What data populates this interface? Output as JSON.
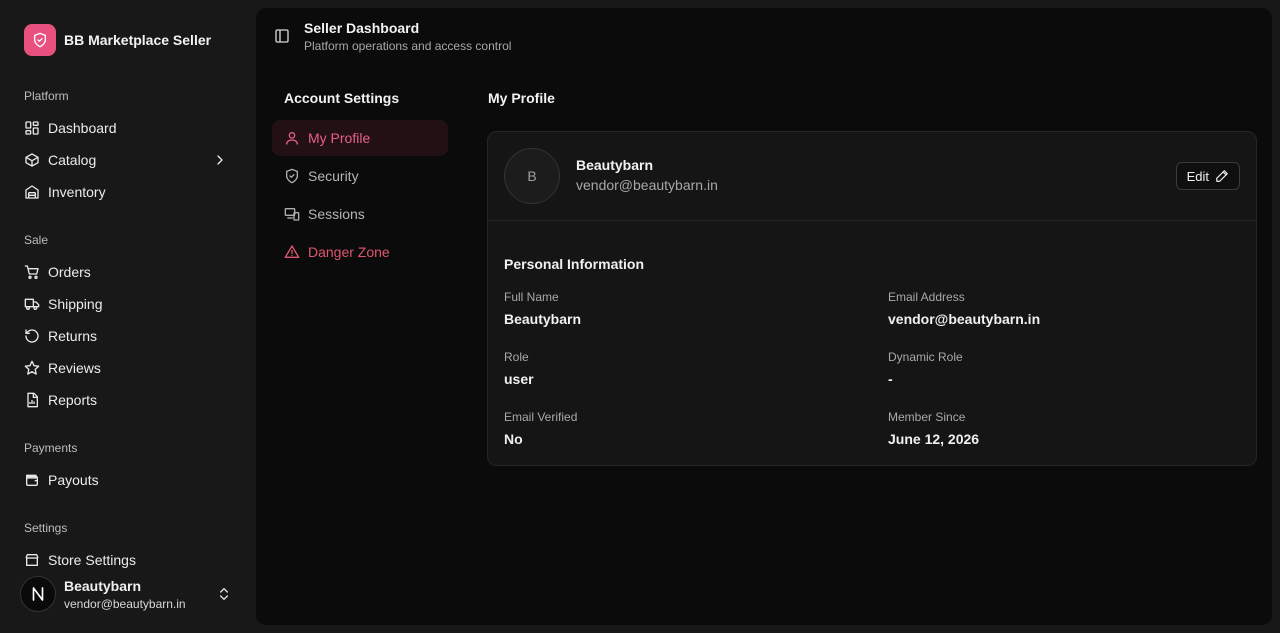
{
  "brand": {
    "name": "BB Marketplace Seller",
    "logo_icon": "shield-check-icon",
    "accent": "#e8517f"
  },
  "sidebar": {
    "groups": [
      {
        "title": "Platform",
        "items": [
          {
            "label": "Dashboard",
            "icon": "dashboard-icon"
          },
          {
            "label": "Catalog",
            "icon": "package-icon",
            "has_submenu": true
          },
          {
            "label": "Inventory",
            "icon": "warehouse-icon"
          }
        ]
      },
      {
        "title": "Sale",
        "items": [
          {
            "label": "Orders",
            "icon": "cart-icon"
          },
          {
            "label": "Shipping",
            "icon": "truck-icon"
          },
          {
            "label": "Returns",
            "icon": "rotate-ccw-icon"
          },
          {
            "label": "Reviews",
            "icon": "star-icon"
          },
          {
            "label": "Reports",
            "icon": "report-icon"
          }
        ]
      },
      {
        "title": "Payments",
        "items": [
          {
            "label": "Payouts",
            "icon": "wallet-icon"
          }
        ]
      },
      {
        "title": "Settings",
        "items": [
          {
            "label": "Store Settings",
            "icon": "store-icon"
          }
        ]
      }
    ]
  },
  "user": {
    "name": "Beautybarn",
    "email": "vendor@beautybarn.in",
    "avatar_glyph": "N"
  },
  "header": {
    "title": "Seller Dashboard",
    "subtitle": "Platform operations and access control"
  },
  "settings_nav": {
    "title": "Account Settings",
    "items": [
      {
        "label": "My Profile",
        "icon": "user-icon",
        "active": true
      },
      {
        "label": "Security",
        "icon": "shield-icon"
      },
      {
        "label": "Sessions",
        "icon": "devices-icon"
      },
      {
        "label": "Danger Zone",
        "icon": "alert-triangle-icon",
        "danger": true
      }
    ]
  },
  "profile": {
    "title": "My Profile",
    "avatar_initial": "B",
    "name": "Beautybarn",
    "email": "vendor@beautybarn.in",
    "edit_label": "Edit",
    "section_title": "Personal Information",
    "fields": [
      {
        "label": "Full Name",
        "value": "Beautybarn"
      },
      {
        "label": "Email Address",
        "value": "vendor@beautybarn.in"
      },
      {
        "label": "Role",
        "value": "user"
      },
      {
        "label": "Dynamic Role",
        "value": "-"
      },
      {
        "label": "Email Verified",
        "value": "No"
      },
      {
        "label": "Member Since",
        "value": "June 12, 2026"
      }
    ]
  },
  "colors": {
    "background": "#181818",
    "panel": "#0b0b0b",
    "card": "#151515",
    "active_text": "#e8608a",
    "danger": "#e0566f"
  }
}
